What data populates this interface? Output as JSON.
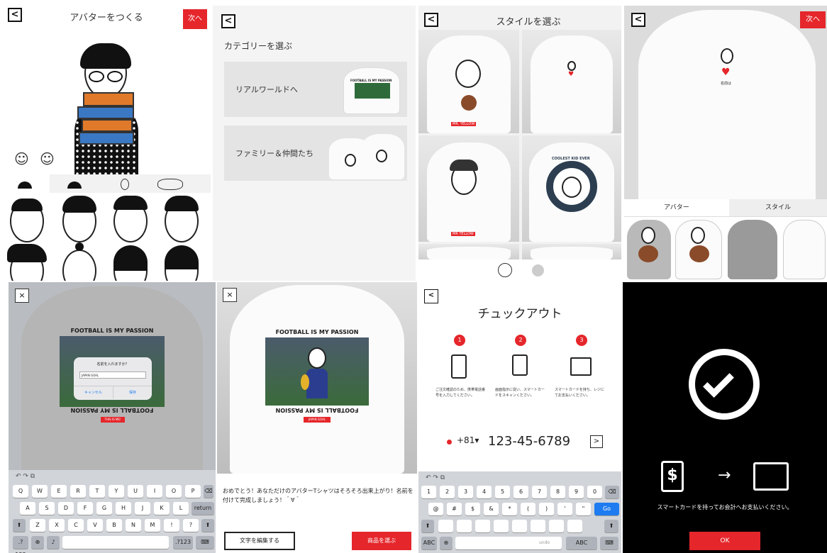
{
  "avatar": {
    "title": "アバターをつくる",
    "next": "次へ",
    "back": "<",
    "face_icons": [
      "☺",
      "☺"
    ],
    "hair_count": 6
  },
  "category": {
    "back": "<",
    "heading": "カテゴリーを選ぶ",
    "cards": [
      {
        "label": "リアルワールドへ",
        "shirt_text": "FOOTBALL IS MY PASSION"
      },
      {
        "label": "ファミリー＆仲間たち"
      }
    ]
  },
  "style": {
    "back": "<",
    "title": "スタイルを選ぶ",
    "shirt_labels": [
      "MR. YELLOW",
      "",
      "MR YELLOW",
      ""
    ],
    "ring_text": "COOLEST KID EVER"
  },
  "preview": {
    "back": "<",
    "next": "次へ",
    "tabs": [
      "アバター",
      "スタイル"
    ],
    "name_text": "名前は"
  },
  "name_dialog": {
    "close": "×",
    "shirt_top": "FOOTBALL IS MY PASSION",
    "shirt_bottom": "FOOTBALL IS MY PASSION",
    "tag": "THIS IS ME!",
    "dialog_title": "名前を入れますか？",
    "dialog_value": "JAPAN GOAL",
    "cancel": "キャンセル",
    "ok": "保存"
  },
  "keyboard1": {
    "row1": [
      "Q",
      "W",
      "E",
      "R",
      "T",
      "Y",
      "U",
      "I",
      "O",
      "P"
    ],
    "row2": [
      "A",
      "S",
      "D",
      "F",
      "G",
      "H",
      "J",
      "K",
      "L"
    ],
    "row3": [
      "Z",
      "X",
      "C",
      "V",
      "B",
      "N",
      "M",
      "!",
      "?"
    ],
    "return": "return",
    "num": ".?123",
    "num2": ".?123"
  },
  "complete": {
    "close": "×",
    "shirt_top": "FOOTBALL IS MY PASSION",
    "shirt_bottom": "FOOTBALL IS MY PASSION",
    "tag": "JAPAN GOAL",
    "message": "おめでとう！あなただけのアバターTシャツはそろそろ出来上がり！名前を付けて完成しましょう！＾∀＾",
    "edit": "文字を編集する",
    "choose": "商品を選ぶ"
  },
  "checkout": {
    "back": "<",
    "title": "チュックアウト",
    "steps": [
      {
        "n": "1",
        "text": "ご注文確認のため、携帯電話番号を入力してください。"
      },
      {
        "n": "2",
        "text": "画面指示に従い、スマートカードをスキャンください。"
      },
      {
        "n": "3",
        "text": "スマートカードを持ち、レジにてお支払いください。"
      }
    ],
    "code": "+81",
    "code_caret": "▾",
    "phone": "123-45-6789",
    "submit": ">",
    "numrow": [
      "1",
      "2",
      "3",
      "4",
      "5",
      "6",
      "7",
      "8",
      "9",
      "0"
    ],
    "symrow": [
      "@",
      "#",
      "$",
      "&",
      "*",
      "(",
      ")",
      "'",
      "\""
    ],
    "go": "Go",
    "abc": "ABC",
    "undo": "undo"
  },
  "done": {
    "message": "スマートカードを持ってお会計へお支払いください。",
    "ok": "OK",
    "arrow": "→"
  }
}
